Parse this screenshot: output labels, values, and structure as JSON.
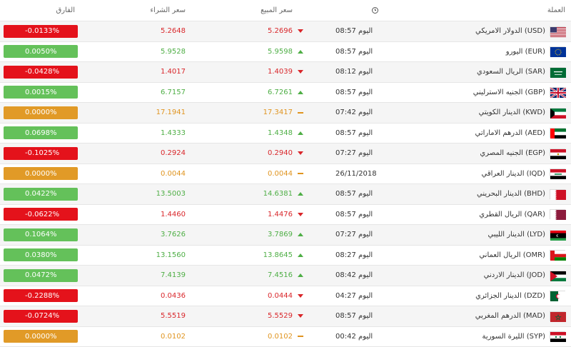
{
  "header": {
    "currency": "العملة",
    "sell": "سعر المبيع",
    "buy": "سعر الشراء",
    "diff": "الفارق",
    "time_icon": "clock-icon"
  },
  "rows": [
    {
      "name": "الدولار الامريكي (USD)",
      "time": "اليوم 08:57",
      "sell": "5.2696",
      "buy": "5.2648",
      "diff": "-0.0133%",
      "trend": "down",
      "flag": "us"
    },
    {
      "name": "اليورو (EUR)",
      "time": "اليوم 08:57",
      "sell": "5.9598",
      "buy": "5.9528",
      "diff": "0.0050%",
      "trend": "up",
      "flag": "eu"
    },
    {
      "name": "الريال السعودي (SAR)",
      "time": "اليوم 08:12",
      "sell": "1.4039",
      "buy": "1.4017",
      "diff": "-0.0428%",
      "trend": "down",
      "flag": "sa"
    },
    {
      "name": "الجنيه الاسترليني (GBP)",
      "time": "اليوم 08:57",
      "sell": "6.7261",
      "buy": "6.7157",
      "diff": "0.0015%",
      "trend": "up",
      "flag": "gb"
    },
    {
      "name": "الدينار الكويتي (KWD)",
      "time": "اليوم 07:42",
      "sell": "17.3417",
      "buy": "17.1941",
      "diff": "0.0000%",
      "trend": "same",
      "flag": "kw"
    },
    {
      "name": "الدرهم الاماراتي (AED)",
      "time": "اليوم 08:57",
      "sell": "1.4348",
      "buy": "1.4333",
      "diff": "0.0698%",
      "trend": "up",
      "flag": "ae"
    },
    {
      "name": "الجنيه المصري (EGP)",
      "time": "اليوم 07:27",
      "sell": "0.2940",
      "buy": "0.2924",
      "diff": "-0.1025%",
      "trend": "down",
      "flag": "eg"
    },
    {
      "name": "الدينار العراقي (IQD)",
      "time": "26/11/2018",
      "sell": "0.0044",
      "buy": "0.0044",
      "diff": "0.0000%",
      "trend": "same",
      "flag": "iq"
    },
    {
      "name": "الدينار البحريني (BHD)",
      "time": "اليوم 08:57",
      "sell": "14.6381",
      "buy": "13.5003",
      "diff": "0.0422%",
      "trend": "up",
      "flag": "bh"
    },
    {
      "name": "الريال القطري (QAR)",
      "time": "اليوم 08:57",
      "sell": "1.4476",
      "buy": "1.4460",
      "diff": "-0.0622%",
      "trend": "down",
      "flag": "qa"
    },
    {
      "name": "الدينار الليبي (LYD)",
      "time": "اليوم 07:27",
      "sell": "3.7869",
      "buy": "3.7626",
      "diff": "0.1064%",
      "trend": "up",
      "flag": "ly"
    },
    {
      "name": "الريال العماني (OMR)",
      "time": "اليوم 08:27",
      "sell": "13.8645",
      "buy": "13.1560",
      "diff": "0.0380%",
      "trend": "up",
      "flag": "om"
    },
    {
      "name": "الدينار الاردني (JOD)",
      "time": "اليوم 08:42",
      "sell": "7.4516",
      "buy": "7.4139",
      "diff": "0.0472%",
      "trend": "up",
      "flag": "jo"
    },
    {
      "name": "الدينار الجزائري (DZD)",
      "time": "اليوم 04:27",
      "sell": "0.0444",
      "buy": "0.0436",
      "diff": "-0.2288%",
      "trend": "down",
      "flag": "dz"
    },
    {
      "name": "الدرهم المغربي (MAD)",
      "time": "اليوم 08:57",
      "sell": "5.5529",
      "buy": "5.5519",
      "diff": "-0.0724%",
      "trend": "down",
      "flag": "ma"
    },
    {
      "name": "الليرة السورية (SYP)",
      "time": "اليوم 00:42",
      "sell": "0.0102",
      "buy": "0.0102",
      "diff": "0.0000%",
      "trend": "same",
      "flag": "sy"
    }
  ],
  "colors": {
    "down": "#e4121b",
    "up": "#64c15a",
    "same": "#e19a27"
  }
}
